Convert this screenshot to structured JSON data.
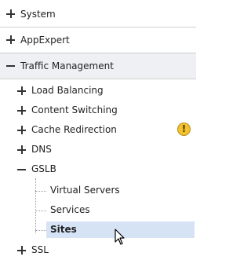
{
  "tree": {
    "top_items": [
      {
        "label": "System",
        "state": "collapsed"
      },
      {
        "label": "AppExpert",
        "state": "collapsed"
      },
      {
        "label": "Traffic Management",
        "state": "expanded"
      }
    ],
    "traffic_management_children": [
      {
        "label": "Load Balancing",
        "state": "collapsed"
      },
      {
        "label": "Content Switching",
        "state": "collapsed"
      },
      {
        "label": "Cache Redirection",
        "state": "collapsed",
        "badge": "!"
      },
      {
        "label": "DNS",
        "state": "collapsed"
      },
      {
        "label": "GSLB",
        "state": "expanded"
      }
    ],
    "gslb_children": [
      {
        "label": "Virtual Servers"
      },
      {
        "label": "Services"
      },
      {
        "label": "Sites",
        "selected": true
      }
    ],
    "after_gslb": [
      {
        "label": "SSL",
        "state": "collapsed"
      }
    ]
  },
  "colors": {
    "selection": "#d6e3f5",
    "warning": "#f2c230",
    "expanded_header": "#eef0f3"
  }
}
